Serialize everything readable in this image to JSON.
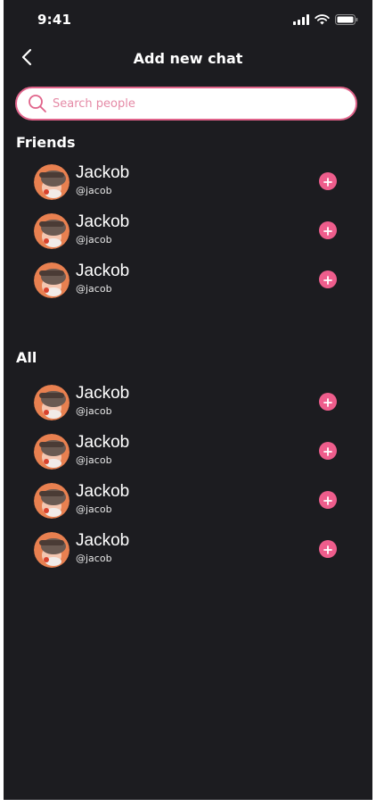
{
  "status_bar": {
    "time": "9:41",
    "icons": [
      "signal-icon",
      "wifi-icon",
      "battery-icon"
    ]
  },
  "header": {
    "back_icon": "chevron-left-icon",
    "title": "Add new chat"
  },
  "search": {
    "placeholder": "Search people",
    "value": ""
  },
  "sections": {
    "friends": {
      "title": "Friends",
      "contacts": [
        {
          "name": "Jackob",
          "handle": "@jacob"
        },
        {
          "name": "Jackob",
          "handle": "@jacob"
        },
        {
          "name": "Jackob",
          "handle": "@jacob"
        }
      ]
    },
    "all": {
      "title": "All",
      "contacts": [
        {
          "name": "Jackob",
          "handle": "@jacob"
        },
        {
          "name": "Jackob",
          "handle": "@jacob"
        },
        {
          "name": "Jackob",
          "handle": "@jacob"
        },
        {
          "name": "Jackob",
          "handle": "@jacob"
        }
      ]
    }
  },
  "colors": {
    "background": "#1c1c20",
    "accent": "#ee5d8c",
    "search_border": "#e0638a"
  }
}
